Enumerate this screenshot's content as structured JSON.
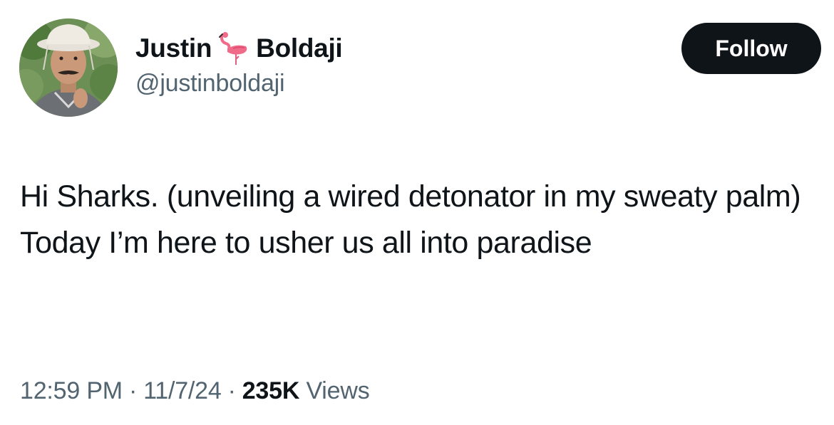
{
  "author": {
    "first_name": "Justin",
    "last_name": "Boldaji",
    "name_emoji": "flamingo-icon",
    "handle": "@justinboldaji",
    "avatar_icon": "profile-photo"
  },
  "follow_button": {
    "label": "Follow"
  },
  "tweet": {
    "text": "Hi Sharks. (unveiling a wired detonator in my sweaty palm) Today I’m here to usher us all into paradise"
  },
  "meta": {
    "time": "12:59 PM",
    "separator": "·",
    "date": "11/7/24",
    "views_count": "235K",
    "views_label": "Views"
  },
  "colors": {
    "text_primary": "#0f1419",
    "text_secondary": "#536471",
    "button_bg": "#0f1419",
    "button_text": "#ffffff",
    "flamingo": "#f06b8a"
  }
}
